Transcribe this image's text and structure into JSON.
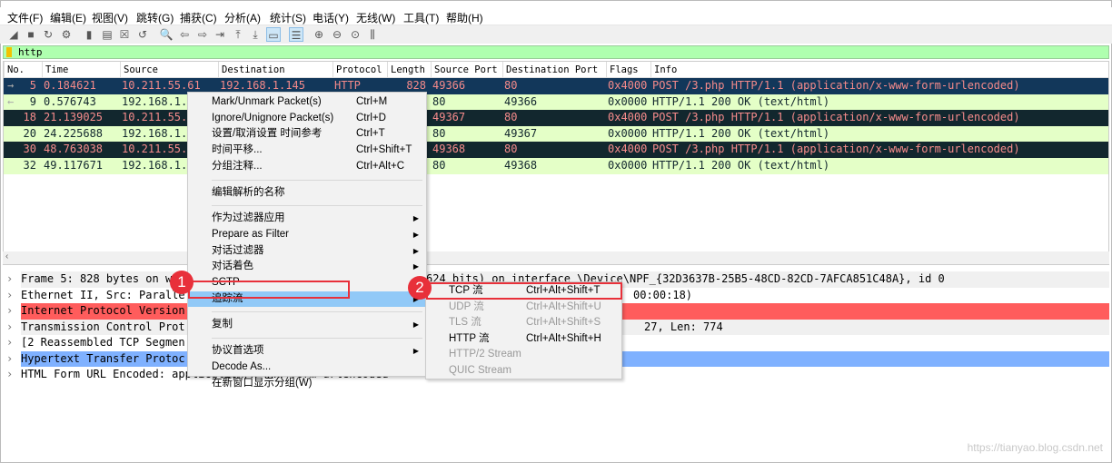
{
  "menubar": [
    "文件(F)",
    "编辑(E)",
    "视图(V)",
    "跳转(G)",
    "捕获(C)",
    "分析(A)",
    "统计(S)",
    "电话(Y)",
    "无线(W)",
    "工具(T)",
    "帮助(H)"
  ],
  "toolbar": [
    {
      "icon": "start-capture-icon",
      "glyph": "◢"
    },
    {
      "icon": "stop-capture-icon",
      "glyph": "■"
    },
    {
      "icon": "restart-capture-icon",
      "glyph": "↻"
    },
    {
      "icon": "capture-options-icon",
      "glyph": "⚙"
    },
    {
      "icon": "open-file-icon",
      "glyph": "▮"
    },
    {
      "icon": "save-file-icon",
      "glyph": "▤"
    },
    {
      "icon": "close-file-icon",
      "glyph": "☒"
    },
    {
      "icon": "reload-icon",
      "glyph": "↺"
    },
    {
      "icon": "find-packet-icon",
      "glyph": "🔍"
    },
    {
      "icon": "go-back-icon",
      "glyph": "⇦"
    },
    {
      "icon": "go-forward-icon",
      "glyph": "⇨"
    },
    {
      "icon": "go-to-packet-icon",
      "glyph": "⇥"
    },
    {
      "icon": "first-packet-icon",
      "glyph": "⤒"
    },
    {
      "icon": "last-packet-icon",
      "glyph": "⤓"
    },
    {
      "icon": "autoscroll-icon",
      "glyph": "▭"
    },
    {
      "icon": "colorize-icon",
      "glyph": "☰"
    },
    {
      "icon": "zoom-in-icon",
      "glyph": "⊕"
    },
    {
      "icon": "zoom-out-icon",
      "glyph": "⊖"
    },
    {
      "icon": "zoom-reset-icon",
      "glyph": "⊙"
    },
    {
      "icon": "resize-columns-icon",
      "glyph": "⫼"
    }
  ],
  "filter": {
    "value": "http"
  },
  "columns": [
    "No.",
    "Time",
    "Source",
    "Destination",
    "Protocol",
    "Length",
    "Source Port",
    "Destination Port",
    "Flags",
    "Info"
  ],
  "packets": [
    {
      "no": "5",
      "time": "0.184621",
      "src": "10.211.55.61",
      "dst": "192.168.1.145",
      "proto": "HTTP",
      "len": "828",
      "sport": "49366",
      "dport": "80",
      "flags": "0x4000",
      "info": "POST /3.php HTTP/1.1  (application/x-www-form-urlencoded)",
      "style": "sel"
    },
    {
      "no": "9",
      "time": "0.576743",
      "src": "192.168.1.",
      "dst": "",
      "proto": "",
      "len": "",
      "sport": "80",
      "dport": "49366",
      "flags": "0x0000",
      "info": "HTTP/1.1 200 OK  (text/html)",
      "style": "lt"
    },
    {
      "no": "18",
      "time": "21.139025",
      "src": "10.211.55.",
      "dst": "",
      "proto": "",
      "len": "",
      "sport": "49367",
      "dport": "80",
      "flags": "0x4000",
      "info": "POST /3.php HTTP/1.1  (application/x-www-form-urlencoded)",
      "style": "dk"
    },
    {
      "no": "20",
      "time": "24.225688",
      "src": "192.168.1.",
      "dst": "",
      "proto": "",
      "len": "",
      "sport": "80",
      "dport": "49367",
      "flags": "0x0000",
      "info": "HTTP/1.1 200 OK  (text/html)",
      "style": "lt"
    },
    {
      "no": "30",
      "time": "48.763038",
      "src": "10.211.55.",
      "dst": "",
      "proto": "",
      "len": "",
      "sport": "49368",
      "dport": "80",
      "flags": "0x4000",
      "info": "POST /3.php HTTP/1.1  (application/x-www-form-urlencoded)",
      "style": "dk"
    },
    {
      "no": "32",
      "time": "49.117671",
      "src": "192.168.1.",
      "dst": "",
      "proto": "",
      "len": "",
      "sport": "80",
      "dport": "49368",
      "flags": "0x0000",
      "info": "HTTP/1.1 200 OK  (text/html)",
      "style": "lt"
    }
  ],
  "details": [
    {
      "left": "Frame 5: 828 bytes on w",
      "right": "624 bits) on interface \\Device\\NPF_{32D3637B-25B5-48CD-82CD-7AFCA851C48A}, id 0",
      "style": "gray"
    },
    {
      "left": "Ethernet II, Src: Paralle",
      "right": "00:00:18)",
      "style": ""
    },
    {
      "left": "Internet Protocol Version",
      "right": "",
      "style": "red"
    },
    {
      "left": "Transmission Control Prot",
      "right": "27, Len: 774",
      "style": "gray"
    },
    {
      "left": "[2 Reassembled TCP Segmen",
      "right": "",
      "style": ""
    },
    {
      "left": "Hypertext Transfer Protoc",
      "right": "",
      "style": "blue"
    },
    {
      "left": "HTML Form URL Encoded: application/x-www-form-urlencoded",
      "right": "",
      "style": ""
    }
  ],
  "context_menu": [
    {
      "label": "Mark/Unmark Packet(s)",
      "shortcut": "Ctrl+M"
    },
    {
      "label": "Ignore/Unignore Packet(s)",
      "shortcut": "Ctrl+D"
    },
    {
      "label": "设置/取消设置 时间参考",
      "shortcut": "Ctrl+T"
    },
    {
      "label": "时间平移...",
      "shortcut": "Ctrl+Shift+T"
    },
    {
      "label": "分组注释...",
      "shortcut": "Ctrl+Alt+C"
    },
    {
      "sep": true
    },
    {
      "label": "编辑解析的名称"
    },
    {
      "sep": true
    },
    {
      "label": "作为过滤器应用",
      "submenu": true
    },
    {
      "label": "Prepare as Filter",
      "submenu": true
    },
    {
      "label": "对话过滤器",
      "submenu": true
    },
    {
      "label": "对话着色",
      "submenu": true
    },
    {
      "label": "SCTP",
      "submenu": true
    },
    {
      "label": "追踪流",
      "submenu": true,
      "highlighted": true
    },
    {
      "sep": true
    },
    {
      "label": "复制",
      "submenu": true
    },
    {
      "sep": true
    },
    {
      "label": "协议首选项",
      "submenu": true
    },
    {
      "label": "Decode As..."
    },
    {
      "label": "在新窗口显示分组(W)"
    }
  ],
  "submenu": [
    {
      "label": "TCP 流",
      "shortcut": "Ctrl+Alt+Shift+T",
      "enabled": true
    },
    {
      "label": "UDP 流",
      "shortcut": "Ctrl+Alt+Shift+U",
      "enabled": false
    },
    {
      "label": "TLS 流",
      "shortcut": "Ctrl+Alt+Shift+S",
      "enabled": false
    },
    {
      "label": "HTTP 流",
      "shortcut": "Ctrl+Alt+Shift+H",
      "enabled": true
    },
    {
      "label": "HTTP/2 Stream",
      "enabled": false
    },
    {
      "label": "QUIC Stream",
      "enabled": false
    }
  ],
  "annotations": [
    "1",
    "2"
  ],
  "watermark": "https://tianyao.blog.csdn.net",
  "colors": {
    "selected_row": "#12375a",
    "dark_row": "#12272e",
    "light_row": "#e4ffc7",
    "ip_row": "#ff5c5c",
    "http_row": "#7fb1ff",
    "filter_bg": "#afffaf",
    "highlight": "#e8303a"
  }
}
